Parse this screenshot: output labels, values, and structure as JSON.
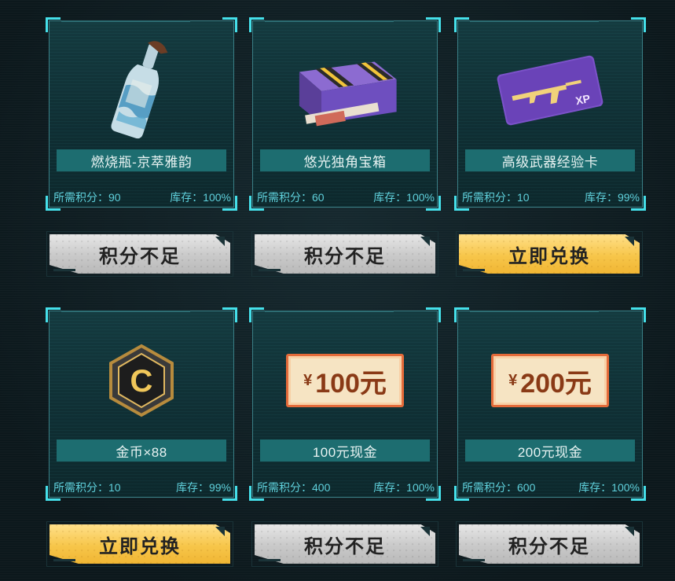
{
  "items": [
    {
      "name": "燃烧瓶-京萃雅韵",
      "points_label": "所需积分：90",
      "stock_label": "库存：100%",
      "button": "积分不足",
      "button_state": "disabled",
      "icon": "molotov-bottle-icon"
    },
    {
      "name": "悠光独角宝箱",
      "points_label": "所需积分：60",
      "stock_label": "库存：100%",
      "button": "积分不足",
      "button_state": "disabled",
      "icon": "treasure-chest-icon"
    },
    {
      "name": "高级武器经验卡",
      "points_label": "所需积分：10",
      "stock_label": "库存：99%",
      "button": "立即兑换",
      "button_state": "active",
      "icon": "weapon-xp-card-icon",
      "card_badge": "XP"
    },
    {
      "name": "金币×88",
      "points_label": "所需积分：10",
      "stock_label": "库存：99%",
      "button": "立即兑换",
      "button_state": "active",
      "icon": "gold-coin-badge-icon",
      "badge_letter": "C"
    },
    {
      "name": "100元现金",
      "points_label": "所需积分：400",
      "stock_label": "库存：100%",
      "button": "积分不足",
      "button_state": "disabled",
      "icon": "cash-ticket-icon",
      "ticket_symbol": "¥",
      "ticket_amount": "100元"
    },
    {
      "name": "200元现金",
      "points_label": "所需积分：600",
      "stock_label": "库存：100%",
      "button": "积分不足",
      "button_state": "disabled",
      "icon": "cash-ticket-icon",
      "ticket_symbol": "¥",
      "ticket_amount": "200元"
    }
  ],
  "colors": {
    "accent": "#45e0ea",
    "name_plate": "#1d6d70",
    "meta_text": "#5fd0db",
    "active_button": "#f7c64a",
    "disabled_button": "#c9c9c9"
  }
}
